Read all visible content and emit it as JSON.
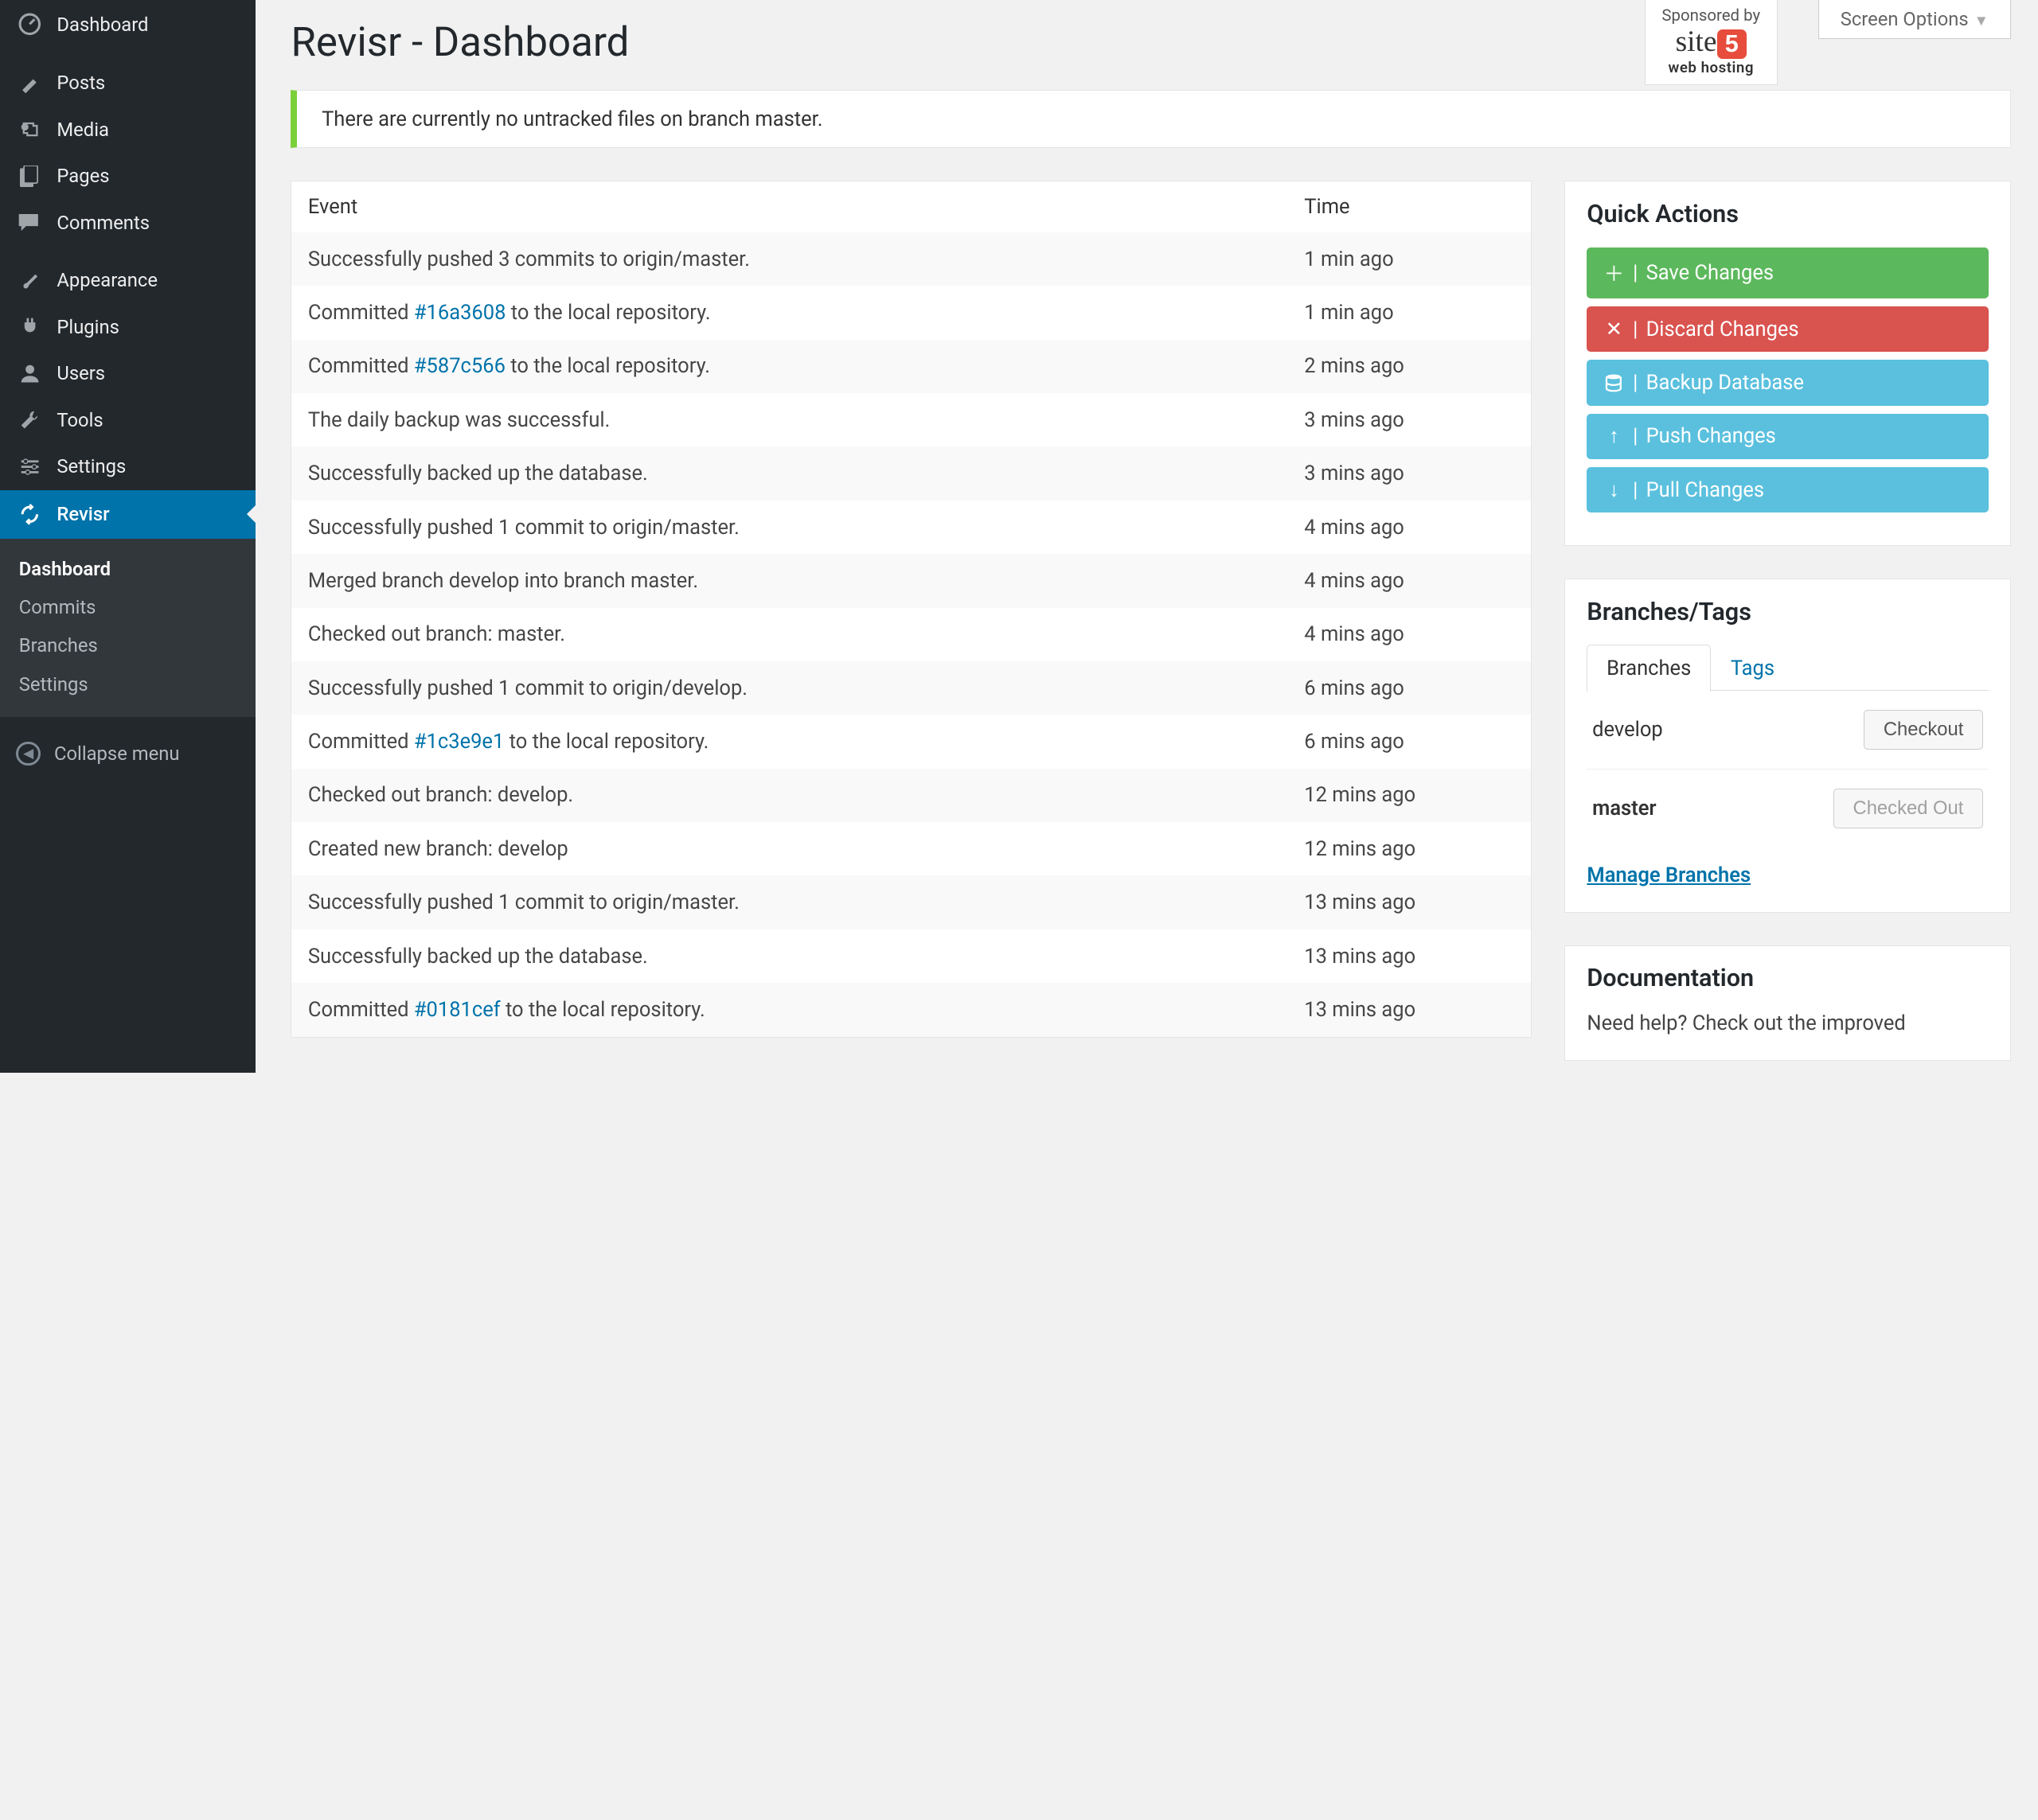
{
  "sidebar": {
    "dashboard": "Dashboard",
    "posts": "Posts",
    "media": "Media",
    "pages": "Pages",
    "comments": "Comments",
    "appearance": "Appearance",
    "plugins": "Plugins",
    "users": "Users",
    "tools": "Tools",
    "settings": "Settings",
    "revisr": "Revisr",
    "sub_dashboard": "Dashboard",
    "sub_commits": "Commits",
    "sub_branches": "Branches",
    "sub_settings": "Settings",
    "collapse": "Collapse menu"
  },
  "topbar": {
    "sponsored": "Sponsored by",
    "site_name": "site",
    "site_sub": "web hosting",
    "screen_options": "Screen Options"
  },
  "page_title": "Revisr - Dashboard",
  "notice": "There are currently no untracked files on branch master.",
  "table": {
    "header_event": "Event",
    "header_time": "Time",
    "rows": [
      {
        "pre": "Successfully pushed 3 commits to origin/master.",
        "link": "",
        "post": "",
        "time": "1 min ago"
      },
      {
        "pre": "Committed ",
        "link": "#16a3608",
        "post": " to the local repository.",
        "time": "1 min ago"
      },
      {
        "pre": "Committed ",
        "link": "#587c566",
        "post": " to the local repository.",
        "time": "2 mins ago"
      },
      {
        "pre": "The daily backup was successful.",
        "link": "",
        "post": "",
        "time": "3 mins ago"
      },
      {
        "pre": "Successfully backed up the database.",
        "link": "",
        "post": "",
        "time": "3 mins ago"
      },
      {
        "pre": "Successfully pushed 1 commit to origin/master.",
        "link": "",
        "post": "",
        "time": "4 mins ago"
      },
      {
        "pre": "Merged branch develop into branch master.",
        "link": "",
        "post": "",
        "time": "4 mins ago"
      },
      {
        "pre": "Checked out branch: master.",
        "link": "",
        "post": "",
        "time": "4 mins ago"
      },
      {
        "pre": "Successfully pushed 1 commit to origin/develop.",
        "link": "",
        "post": "",
        "time": "6 mins ago"
      },
      {
        "pre": "Committed ",
        "link": "#1c3e9e1",
        "post": " to the local repository.",
        "time": "6 mins ago"
      },
      {
        "pre": "Checked out branch: develop.",
        "link": "",
        "post": "",
        "time": "12 mins ago"
      },
      {
        "pre": "Created new branch: develop",
        "link": "",
        "post": "",
        "time": "12 mins ago"
      },
      {
        "pre": "Successfully pushed 1 commit to origin/master.",
        "link": "",
        "post": "",
        "time": "13 mins ago"
      },
      {
        "pre": "Successfully backed up the database.",
        "link": "",
        "post": "",
        "time": "13 mins ago"
      },
      {
        "pre": "Committed ",
        "link": "#0181cef",
        "post": " to the local repository.",
        "time": "13 mins ago"
      }
    ]
  },
  "quick_actions": {
    "title": "Quick Actions",
    "save": "Save Changes",
    "discard": "Discard Changes",
    "backup": "Backup Database",
    "push": "Push Changes",
    "pull": "Pull Changes"
  },
  "branches": {
    "title": "Branches/Tags",
    "tab_branches": "Branches",
    "tab_tags": "Tags",
    "rows": [
      {
        "name": "develop",
        "button": "Checkout",
        "active": false
      },
      {
        "name": "master",
        "button": "Checked Out",
        "active": true
      }
    ],
    "manage": "Manage Branches"
  },
  "documentation": {
    "title": "Documentation",
    "body": "Need help? Check out the improved"
  }
}
